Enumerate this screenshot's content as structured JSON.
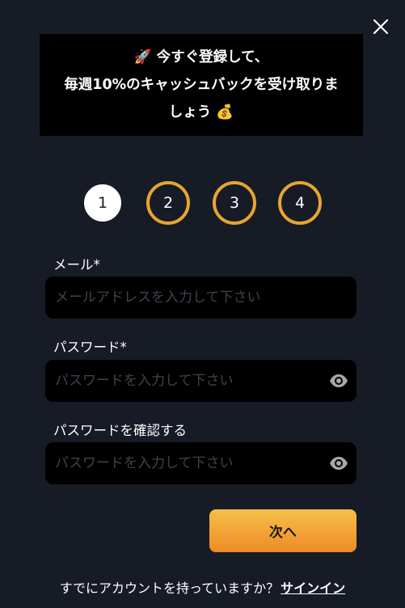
{
  "banner": {
    "line1_emoji": "🚀",
    "line1_text": " 今すぐ登録して、",
    "line2_text": "毎週10%のキャッシュバックを受け取りま",
    "line3_text": "しょう ",
    "line3_emoji": "💰"
  },
  "steps": [
    {
      "label": "1",
      "state": "active"
    },
    {
      "label": "2",
      "state": "inactive"
    },
    {
      "label": "3",
      "state": "inactive"
    },
    {
      "label": "4",
      "state": "inactive"
    }
  ],
  "form": {
    "email_label": "メール",
    "email_required": "*",
    "email_placeholder": "メールアドレスを入力して下さい",
    "password_label": "パスワード",
    "password_required": "*",
    "password_placeholder": "パスワードを入力して下さい",
    "confirm_label": "パスワードを確認する",
    "confirm_placeholder": "パスワードを入力して下さい",
    "next_button": "次へ"
  },
  "footer": {
    "question": "すでにアカウントを持っていますか？",
    "signin_link": "サインイン"
  },
  "colors": {
    "background": "#161b26",
    "accent": "#e7a52f",
    "button_top": "#f6c04a",
    "button_bottom": "#ee8b26"
  },
  "icons": [
    "close-icon",
    "rocket-icon",
    "money-bag-icon",
    "eye-icon"
  ]
}
